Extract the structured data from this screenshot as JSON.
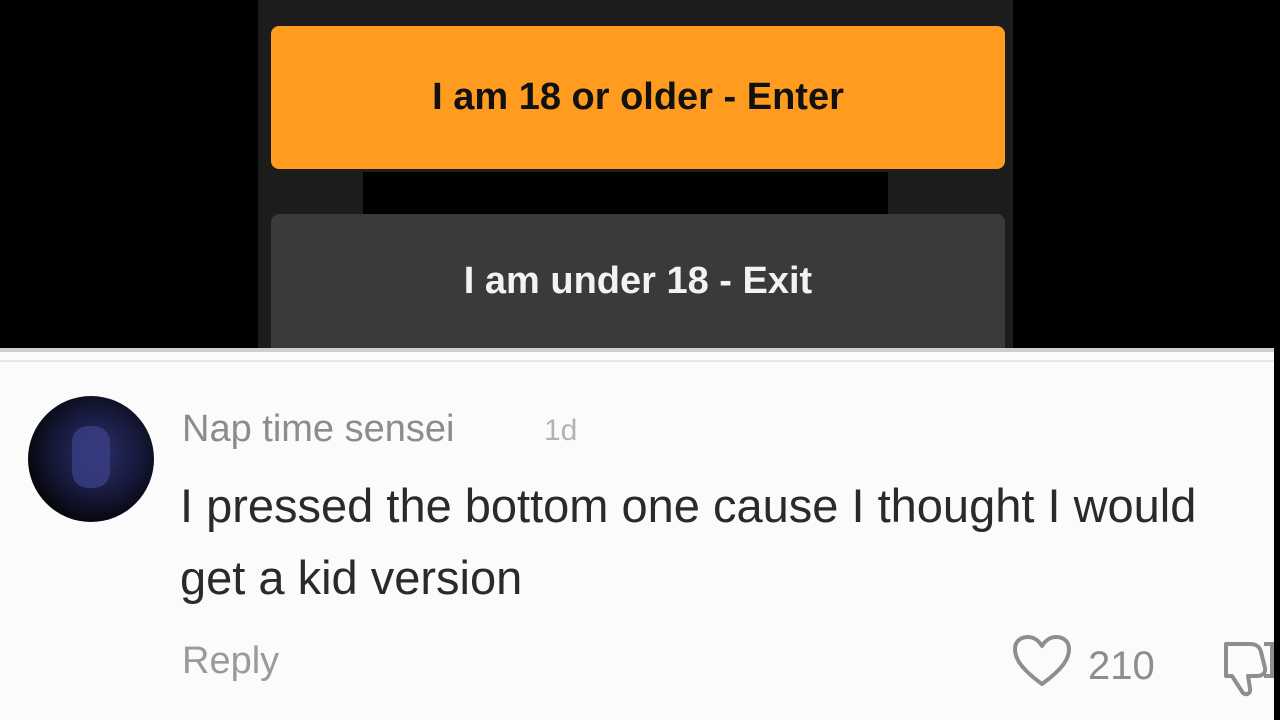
{
  "age_gate": {
    "enter_label": "I am 18 or older - Enter",
    "exit_label": "I am under 18 - Exit"
  },
  "comment": {
    "username": "Nap time sensei",
    "time": "1d",
    "text": "I pressed the bottom one cause I thought I would get a kid version",
    "reply_label": "Reply",
    "like_count": "210"
  },
  "colors": {
    "enter_button": "#ff9b1f",
    "exit_button": "#3a3a3a",
    "background": "#000000",
    "card": "#fbfbfb"
  },
  "icons": {
    "like": "heart-icon",
    "dislike": "thumbs-down-icon"
  }
}
